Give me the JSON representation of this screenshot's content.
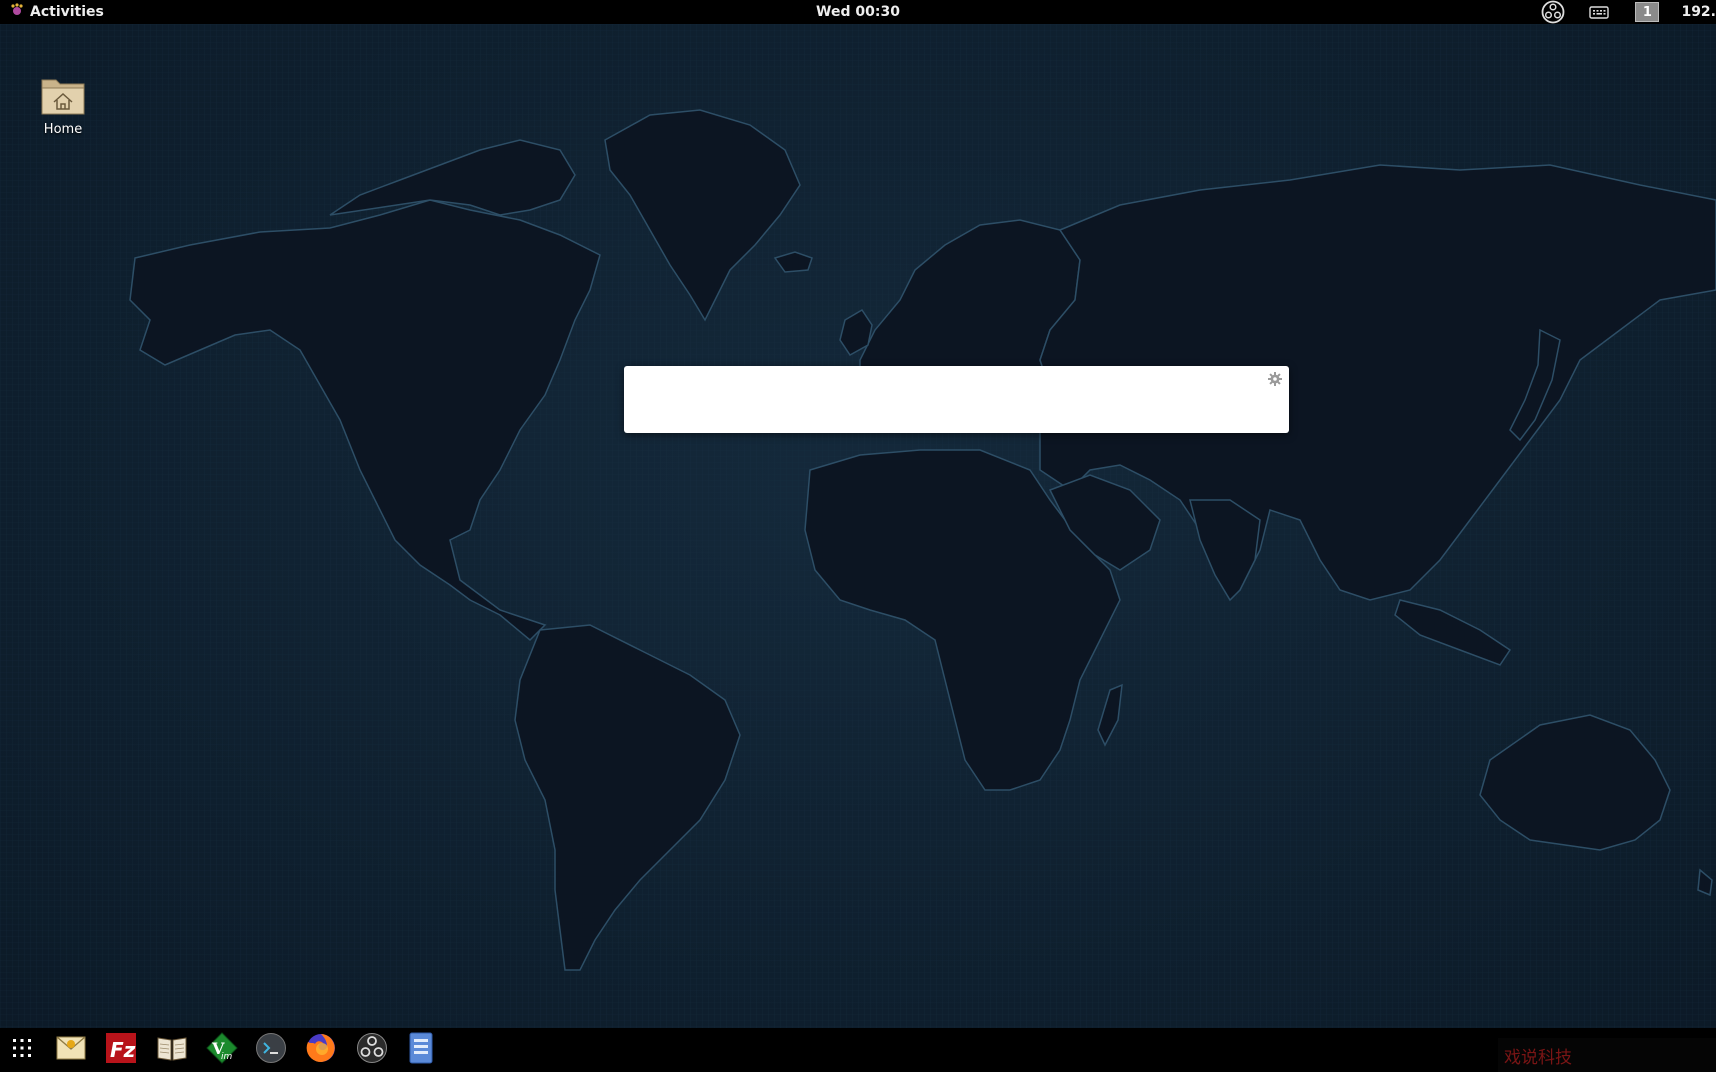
{
  "topbar": {
    "activities_label": "Activities",
    "clock": "Wed 00:30",
    "workspace_number": "1",
    "ip_text": "192."
  },
  "desktop": {
    "icons": [
      {
        "label": "Home",
        "icon": "home-folder-icon"
      }
    ]
  },
  "dialog": {
    "settings_icon": "gear-icon"
  },
  "dock": {
    "apps": [
      {
        "name": "show-applications",
        "icon": "grid-icon"
      },
      {
        "name": "mail-client",
        "icon": "mail-icon"
      },
      {
        "name": "filezilla",
        "icon": "filezilla-icon"
      },
      {
        "name": "dictionary",
        "icon": "book-icon"
      },
      {
        "name": "gvim",
        "icon": "vim-icon"
      },
      {
        "name": "terminal",
        "icon": "terminal-icon"
      },
      {
        "name": "firefox",
        "icon": "firefox-icon"
      },
      {
        "name": "obs-studio",
        "icon": "obs-icon"
      },
      {
        "name": "file-manager",
        "icon": "files-icon"
      }
    ]
  },
  "watermark": {
    "text": "戏说科技"
  }
}
